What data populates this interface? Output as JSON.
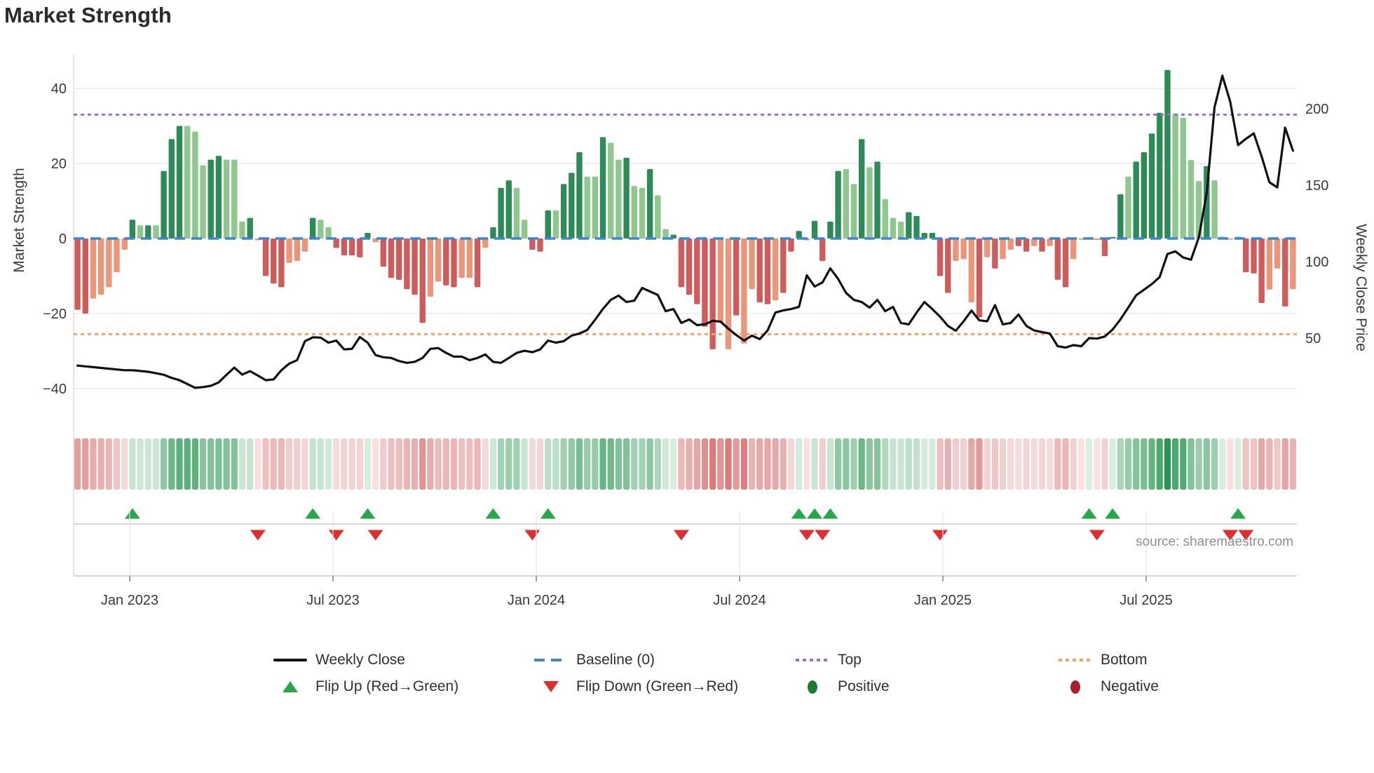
{
  "title": "Market Strength",
  "left_axis": {
    "label": "Market Strength",
    "ticks": [
      40,
      20,
      0,
      -20,
      -40
    ]
  },
  "right_axis": {
    "label": "Weekly Close Price",
    "ticks": [
      200,
      150,
      100,
      50
    ]
  },
  "x_axis": {
    "ticks": [
      "Jan 2023",
      "Jul 2023",
      "Jan 2024",
      "Jul 2024",
      "Jan 2025",
      "Jul 2025"
    ]
  },
  "source": "source: sharemaestro.com",
  "legend": {
    "weekly_close": "Weekly Close",
    "baseline": "Baseline (0)",
    "top": "Top",
    "bottom": "Bottom",
    "flip_up": "Flip Up (Red→Green)",
    "flip_down": "Flip Down (Green→Red)",
    "positive": "Positive",
    "negative": "Negative"
  },
  "colors": {
    "bar_green_dark": "#2e8b57",
    "bar_green_light": "#8fc78f",
    "bar_red_dark": "#cd5c5c",
    "bar_red_light": "#e9967a",
    "baseline_blue": "#3f87c5",
    "top_purple": "#9370db",
    "bottom_orange": "#f4a460",
    "price_line": "#111111",
    "flip_up_green": "#27a64a",
    "flip_down_red": "#dc3030",
    "positive_dot": "#1e7b34",
    "negative_dot": "#a81f2d",
    "grid": "#e9ebf1",
    "tick_text": "#3a3a3a"
  },
  "chart_data": {
    "type": "bar+line+heatmap",
    "frequency": "weekly",
    "n_weeks": 156,
    "start": "Nov 2022",
    "baseline": 0,
    "top_threshold": 33,
    "bottom_threshold": -25.5,
    "left_axis_range": [
      -40,
      40
    ],
    "right_axis_range": [
      50,
      200
    ],
    "bar_values": [
      -19,
      -20,
      -16,
      -15,
      -13,
      -9,
      -3,
      5,
      3.5,
      3.5,
      3.5,
      18,
      26.5,
      30,
      30,
      28.5,
      19.5,
      21,
      22,
      21,
      21,
      4.5,
      5.5,
      -0.5,
      -10,
      -12,
      -13,
      -6.5,
      -6,
      -3.5,
      5.5,
      5,
      3,
      -2.5,
      -4.5,
      -4.5,
      -5,
      1.5,
      -1,
      -7.5,
      -10.5,
      -11,
      -13.5,
      -15,
      -22.5,
      -15.5,
      -11.5,
      -12.5,
      -13,
      -10.5,
      -10.5,
      -13,
      -2.5,
      3,
      13.5,
      15.5,
      13.5,
      5,
      -3,
      -3.5,
      7.5,
      7.5,
      14.5,
      17.5,
      23,
      16.5,
      16.5,
      27,
      25.5,
      21,
      21.5,
      14,
      13.5,
      18.5,
      11.5,
      2.5,
      1,
      -13,
      -15,
      -17.5,
      -23.5,
      -29.5,
      -22.5,
      -29.5,
      -20.5,
      -28,
      -13.5,
      -17,
      -17.5,
      -16.5,
      -14.5,
      -3.5,
      2,
      -0.5,
      4.7,
      -6,
      4.5,
      18,
      18.5,
      14.5,
      26.5,
      19,
      20.5,
      10.5,
      5.5,
      4.5,
      7,
      6,
      1.5,
      1.5,
      -10,
      -14.5,
      -6,
      -5.5,
      -17,
      -21,
      -5,
      -8,
      -5.5,
      -3,
      -2,
      -3.5,
      -2,
      -3.5,
      -2,
      -11,
      -13,
      -5.5,
      -0.3,
      0.3,
      -0.4,
      -4.7,
      0.4,
      11.8,
      16.5,
      20.5,
      23,
      28,
      33.5,
      44.9,
      33.3,
      32.2,
      20.9,
      15.3,
      19.3,
      15.5,
      0.5,
      -0.3,
      0.5,
      -9,
      -9.3,
      -17.2,
      -13.6,
      -8,
      -18.1,
      -13.5
    ],
    "bar_shades": [
      "dr",
      "dr",
      "lr",
      "lr",
      "lr",
      "lr",
      "lr",
      "dg",
      "lg",
      "dg",
      "lg",
      "dg",
      "dg",
      "dg",
      "lg",
      "lg",
      "lg",
      "dg",
      "dg",
      "lg",
      "lg",
      "lg",
      "dg",
      "lr",
      "dr",
      "dr",
      "dr",
      "lr",
      "lr",
      "lr",
      "dg",
      "lg",
      "lg",
      "dr",
      "dr",
      "dr",
      "dr",
      "dg",
      "lr",
      "dr",
      "dr",
      "dr",
      "dr",
      "dr",
      "dr",
      "lr",
      "lr",
      "dr",
      "dr",
      "lr",
      "lr",
      "dr",
      "lr",
      "dg",
      "dg",
      "dg",
      "lg",
      "lg",
      "dr",
      "dr",
      "dg",
      "lg",
      "dg",
      "dg",
      "dg",
      "lg",
      "lg",
      "dg",
      "lg",
      "lg",
      "dg",
      "lg",
      "lg",
      "dg",
      "lg",
      "lg",
      "dg",
      "dr",
      "dr",
      "dr",
      "dr",
      "dr",
      "lr",
      "lr",
      "dr",
      "lr",
      "lr",
      "dr",
      "dr",
      "lr",
      "dr",
      "dr",
      "dg",
      "lr",
      "dg",
      "dr",
      "dg",
      "dg",
      "lg",
      "lg",
      "dg",
      "lg",
      "dg",
      "lg",
      "lg",
      "lg",
      "dg",
      "dg",
      "dg",
      "dg",
      "dr",
      "dr",
      "lr",
      "lr",
      "lr",
      "dr",
      "lr",
      "dr",
      "lr",
      "lr",
      "dr",
      "dr",
      "lr",
      "dr",
      "lr",
      "dr",
      "dr",
      "lr",
      "lr",
      "lg",
      "lr",
      "dr",
      "dg",
      "dg",
      "lg",
      "dg",
      "dg",
      "dg",
      "dg",
      "dg",
      "lg",
      "lg",
      "lg",
      "lg",
      "dg",
      "lg",
      "lg",
      "lr",
      "lg",
      "dr",
      "dr",
      "dr",
      "lr",
      "lr",
      "dr",
      "lr"
    ],
    "price_values": [
      32,
      31.5,
      31,
      30.5,
      30,
      29.5,
      29,
      29,
      28.5,
      28,
      27,
      26,
      24,
      22.5,
      20,
      17.5,
      18,
      18.8,
      21,
      26,
      30.7,
      26.1,
      28.4,
      25.5,
      22.5,
      23,
      29,
      33.3,
      35.6,
      48,
      50.5,
      50.3,
      47,
      48.4,
      42.6,
      43,
      50.7,
      47,
      38.9,
      37.5,
      37,
      35,
      33.8,
      34.5,
      37,
      43,
      43.5,
      40.3,
      37.9,
      37.9,
      35.6,
      37,
      39.3,
      34.5,
      33.8,
      37,
      40.3,
      41.7,
      40.8,
      42.6,
      48.4,
      47,
      48,
      51.6,
      53,
      55.3,
      62,
      69,
      75,
      77.8,
      73.6,
      74.5,
      82.8,
      80.5,
      78.2,
      67.6,
      69,
      59.9,
      62.2,
      58.5,
      59,
      61.3,
      60.8,
      56.2,
      52,
      48.4,
      51.6,
      49.3,
      55,
      66.7,
      68.1,
      69,
      70.4,
      91,
      83.7,
      86.4,
      95.6,
      88.7,
      79.6,
      75,
      73.6,
      69.9,
      75,
      67.6,
      70.4,
      59.9,
      59,
      66.7,
      73.6,
      69,
      64,
      58,
      54.8,
      61,
      68,
      61.6,
      61,
      71.6,
      59,
      59.9,
      65.4,
      58,
      55,
      53.9,
      53,
      44.7,
      43.8,
      45.4,
      44.7,
      50,
      49.7,
      51,
      55.6,
      62.2,
      70,
      78,
      81.6,
      85.3,
      89.9,
      105,
      106.8,
      102.7,
      101.3,
      116,
      145,
      200.9,
      221.6,
      204.6,
      176.2,
      180.3,
      183.9,
      168.8,
      151.9,
      148.6,
      187.6,
      172.5
    ],
    "flip_up_weeks": [
      7,
      30,
      37,
      53,
      60,
      92,
      94,
      96,
      129,
      132,
      148
    ],
    "flip_down_weeks": [
      23,
      33,
      38,
      58,
      77,
      93,
      95,
      110,
      130,
      147,
      149
    ]
  }
}
